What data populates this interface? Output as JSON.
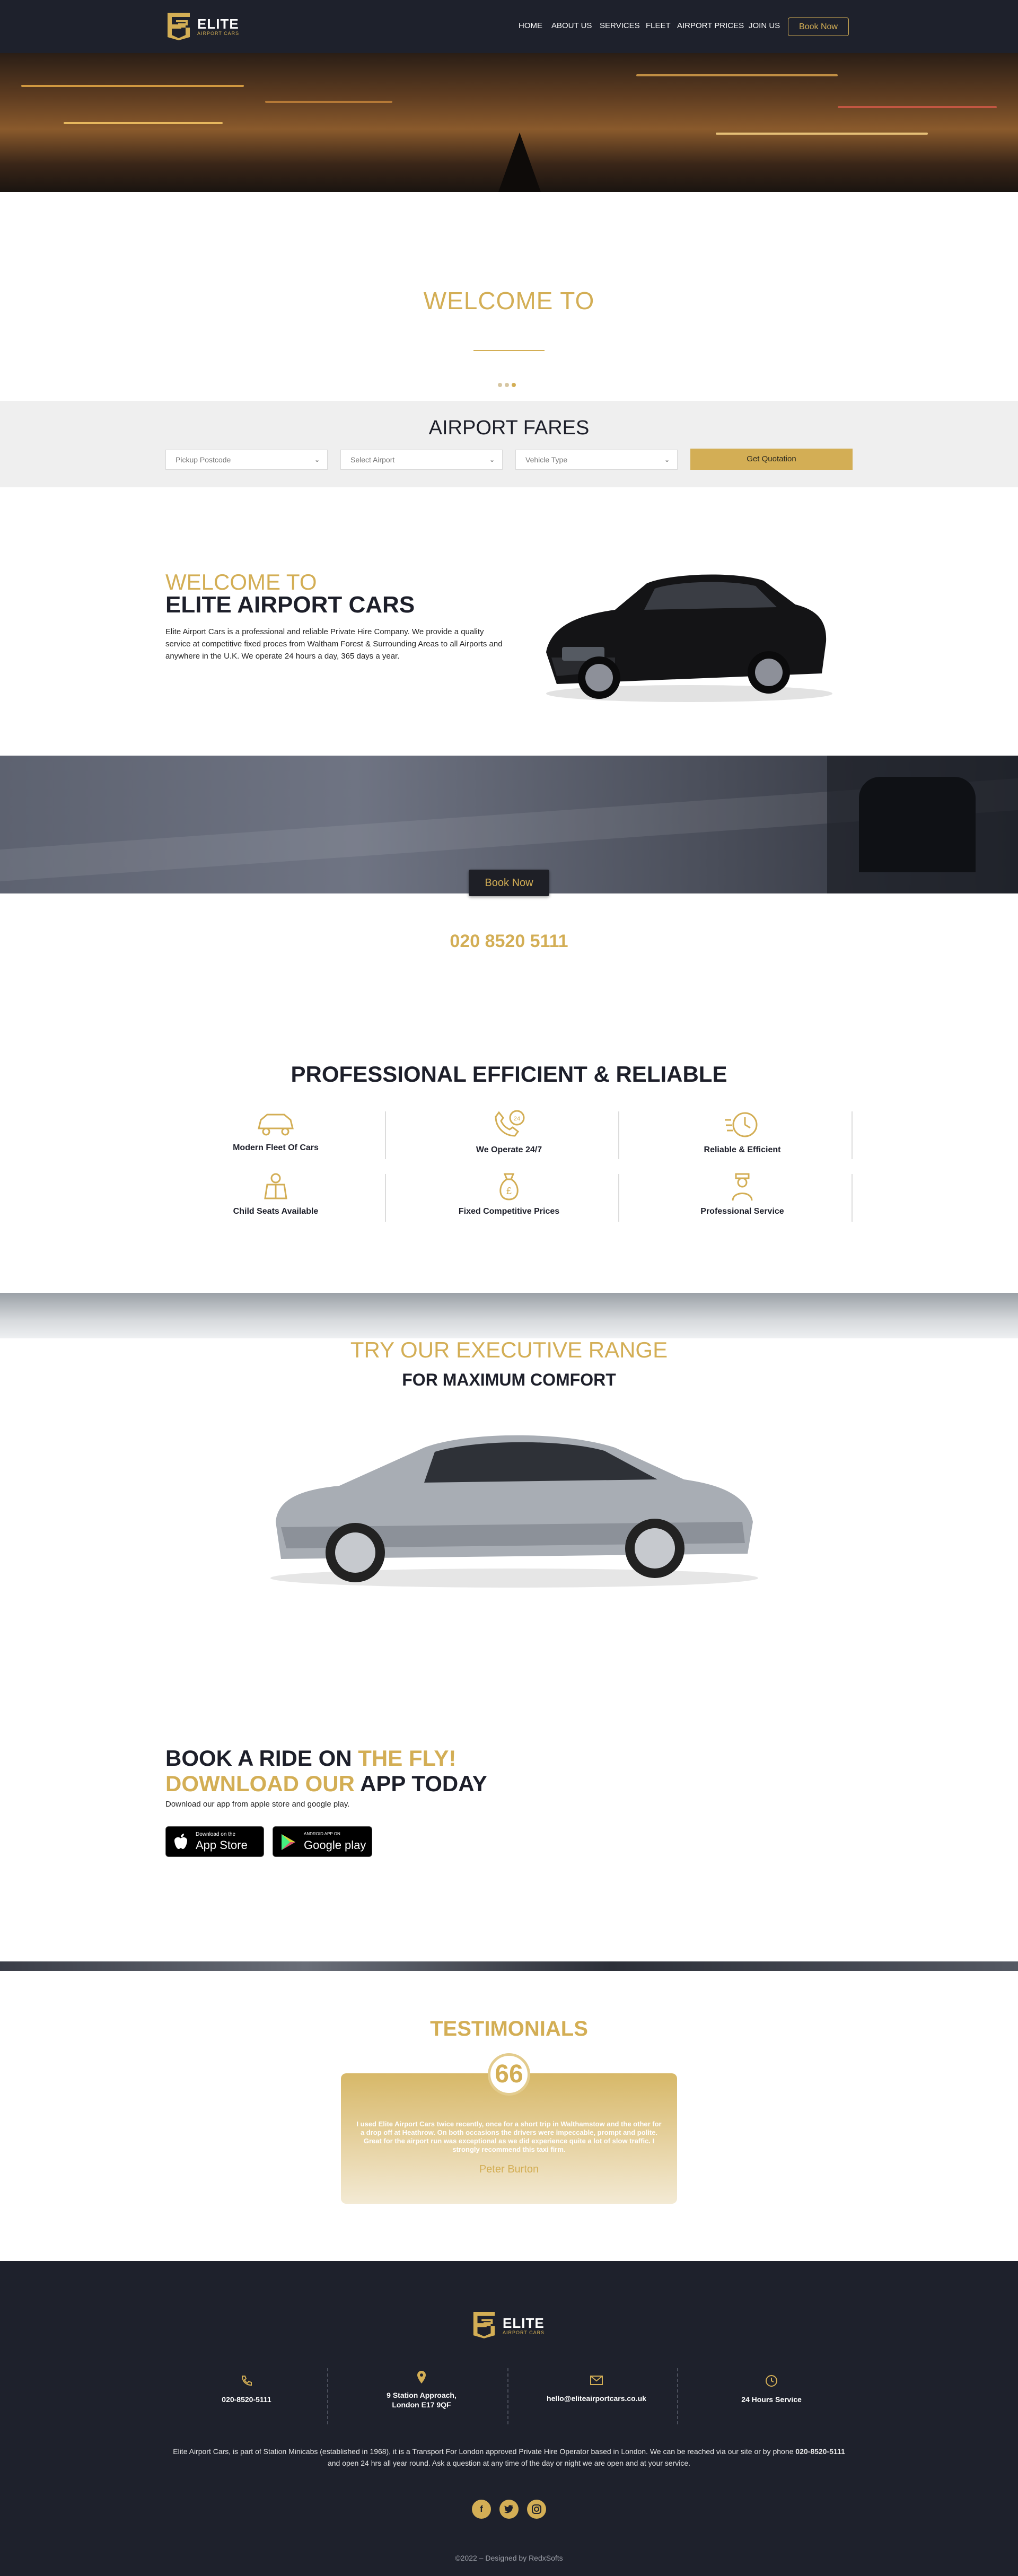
{
  "header": {
    "logo_text": "ELITE",
    "logo_sub": "AIRPORT CARS",
    "nav": [
      "HOME",
      "ABOUT US",
      "SERVICES",
      "FLEET",
      "AIRPORT PRICES",
      "JOIN US"
    ],
    "book_label": "Book Now"
  },
  "welcome": {
    "title": "WELCOME TO"
  },
  "fares": {
    "title": "AIRPORT FARES",
    "pickup_placeholder": "Pickup Postcode",
    "airport_placeholder": "Select Airport",
    "vehicle_placeholder": "Vehicle Type",
    "quote_label": "Get Quotation"
  },
  "intro": {
    "line1": "WELCOME TO",
    "line2": "ELITE AIRPORT CARS",
    "paragraph": "Elite Airport Cars is a professional and reliable Private Hire Company. We provide a quality service at competitive fixed proces from Waltham Forest & Surrounding Areas to all Airports and anywhere in the U.K. We operate 24 hours a day, 365 days a year."
  },
  "book_band": {
    "button": "Book Now",
    "phone": "020 8520 5111"
  },
  "features": {
    "title": "PROFESSIONAL EFFICIENT & RELIABLE",
    "items": [
      {
        "label": "Modern Fleet Of Cars",
        "icon": "car-icon"
      },
      {
        "label": "We Operate 24/7",
        "icon": "phone-24-icon"
      },
      {
        "label": "Reliable & Efficient",
        "icon": "speed-clock-icon"
      },
      {
        "label": "Child Seats Available",
        "icon": "child-seat-icon"
      },
      {
        "label": "Fixed Competitive Prices",
        "icon": "money-bag-icon"
      },
      {
        "label": "Professional Service",
        "icon": "driver-icon"
      }
    ]
  },
  "executive": {
    "line1": "TRY OUR EXECUTIVE RANGE",
    "line2": "FOR MAXIMUM COMFORT"
  },
  "app": {
    "l1_dark": "BOOK A RIDE ON ",
    "l1_gold": "THE FLY!",
    "l2_gold": "DOWNLOAD OUR ",
    "l2_dark": "APP TODAY",
    "subtitle": "Download our app from apple store and google play.",
    "appstore_small": "Download on the",
    "appstore_big": "App Store",
    "google_small": "ANDROID APP ON",
    "google_big": "Google play"
  },
  "testimonials": {
    "title": "TESTIMONIALS",
    "quote_mark": "66",
    "text": "I used Elite Airport Cars twice recently, once for a short trip in Walthamstow and the other for a drop off at Heathrow. On both occasions the drivers were impeccable, prompt and polite. Great for the airport run was exceptional as we did experience quite a lot of slow traffic. I strongly recommend this taxi firm.",
    "author": "Peter Burton"
  },
  "footer": {
    "logo_text": "ELITE",
    "logo_sub": "AIRPORT CARS",
    "phone": "020-8520-5111",
    "address_line1": "9 Station Approach,",
    "address_line2": "London E17 9QF",
    "email": "hello@eliteairportcars.co.uk",
    "hours": "24 Hours Service",
    "para_before": "Elite Airport Cars, is part of Station Minicabs (established in 1968), it is a Transport For London approved Private Hire Operator based in London. We can be reached via our site or by phone ",
    "para_phone": "020-8520-5111",
    "para_after": " and open 24 hrs all year round. Ask a question at any time of the day or night we are open and at your service.",
    "copyright": "©2022 – Designed by RedxSofts"
  },
  "colors": {
    "accent": "#d3ae55",
    "dark": "#1e212c"
  }
}
